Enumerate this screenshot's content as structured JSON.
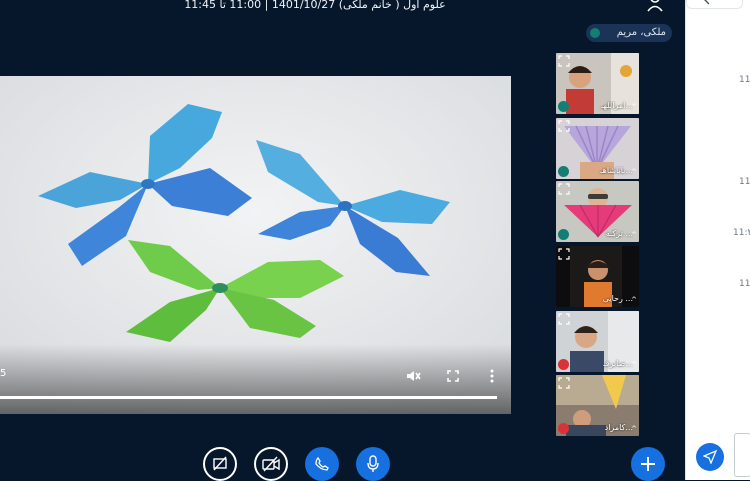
{
  "meeting": {
    "title": "علوم اول ( خانم ملکی) 1401/10/27 | 11:00 تا 11:45",
    "presenter": "ملکی، مریم"
  },
  "video": {
    "time_label": "5",
    "progress": 1.0,
    "description_icons": [
      "mute-icon",
      "fullscreen-icon",
      "more-icon"
    ]
  },
  "participants": [
    {
      "name": "امراللهـ...",
      "mic": "on"
    },
    {
      "name": "باباشاهـ...",
      "mic": "on"
    },
    {
      "name": "ترکـه ...",
      "mic": "on"
    },
    {
      "name": "رحایی ...",
      "mic": "none"
    },
    {
      "name": "صابرفـ...",
      "mic": "muted"
    },
    {
      "name": "کامراد...",
      "mic": "muted"
    }
  ],
  "chat": {
    "timestamps": [
      "11",
      "11:",
      "11:٢",
      "11"
    ]
  },
  "colors": {
    "background": "#06172b",
    "accent": "#1670e0",
    "mic_on": "#137e75",
    "mic_muted": "#d9323a"
  }
}
